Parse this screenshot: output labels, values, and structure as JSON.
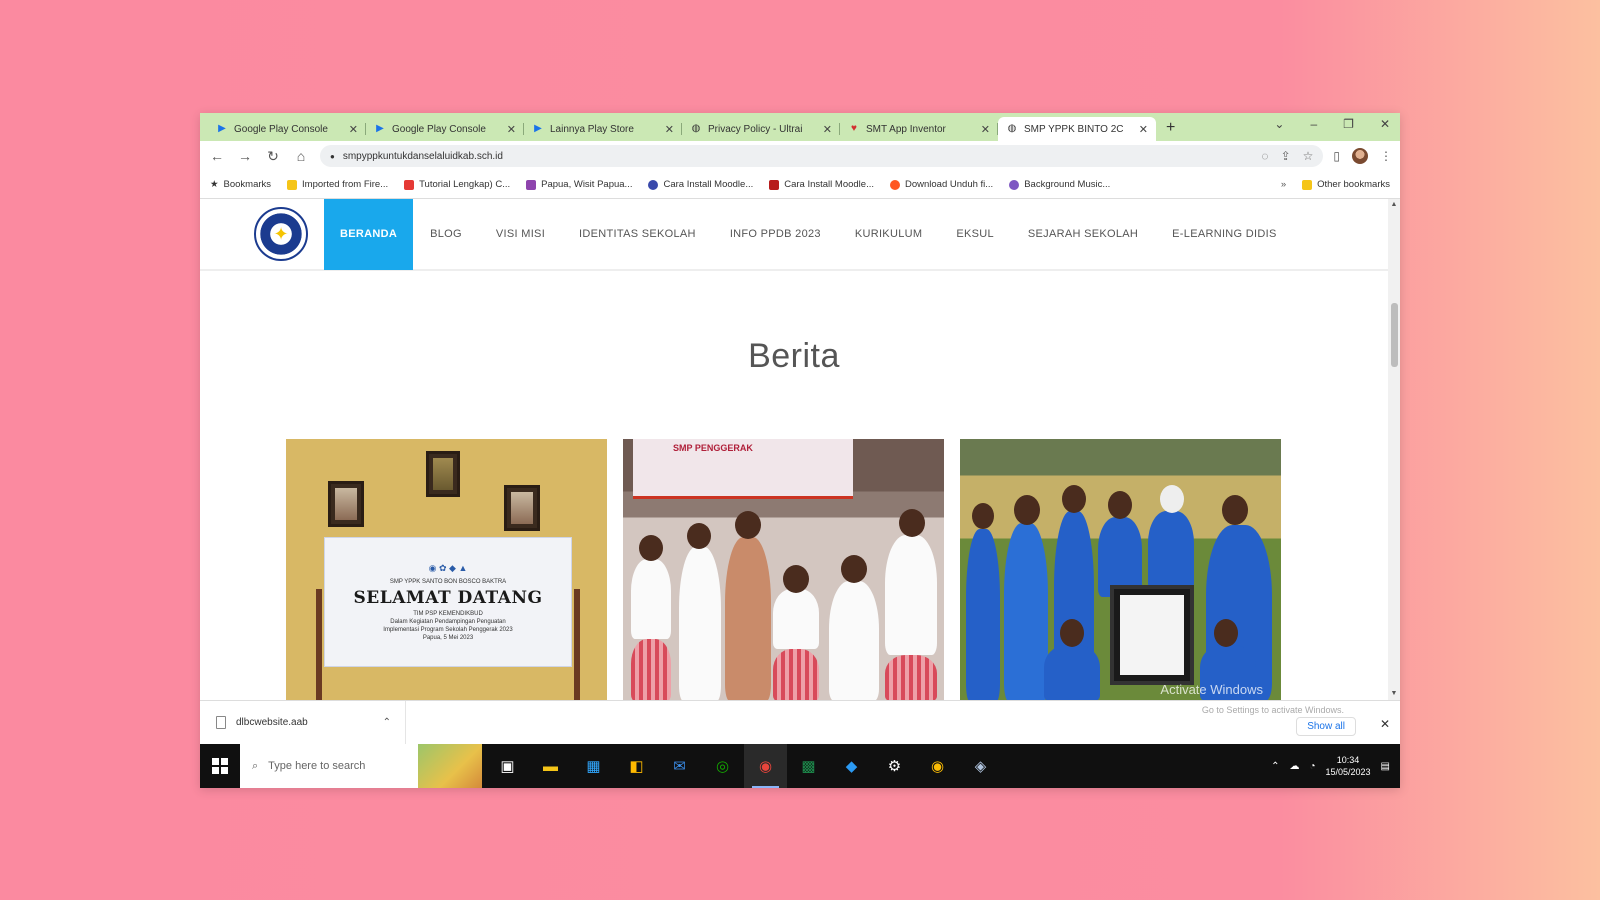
{
  "browser": {
    "tabs": [
      {
        "title": "Google Play Console",
        "icon": "google-play-icon",
        "active": false
      },
      {
        "title": "Google Play Console",
        "icon": "google-play-icon",
        "active": false
      },
      {
        "title": "Lainnya Play Store",
        "icon": "google-play-icon",
        "active": false
      },
      {
        "title": "Privacy Policy - Ultrai",
        "icon": "globe-icon",
        "active": false
      },
      {
        "title": "SMT App Inventor",
        "icon": "app-inventor-icon",
        "active": false
      },
      {
        "title": "SMP YPPK BINTO 2C",
        "icon": "globe-icon",
        "active": true
      }
    ],
    "url": "smpyppkuntukdanselaluidkab.sch.id",
    "bookmarks": [
      {
        "label": "Bookmarks",
        "color": "#222222"
      },
      {
        "label": "Imported from Fire...",
        "color": "#f5c518"
      },
      {
        "label": "Tutorial Lengkap) C...",
        "color": "#e53935"
      },
      {
        "label": "Papua, Wisit Papua...",
        "color": "#8e44ad"
      },
      {
        "label": "Cara Install Moodle...",
        "color": "#3949ab"
      },
      {
        "label": "Cara Install Moodle...",
        "color": "#b71c1c"
      },
      {
        "label": "Download Unduh fi...",
        "color": "#ff5722"
      },
      {
        "label": "Background Music...",
        "color": "#7e57c2"
      }
    ],
    "other_bookmarks": "Other bookmarks"
  },
  "site": {
    "nav": [
      "BERANDA",
      "BLOG",
      "VISI MISI",
      "IDENTITAS SEKOLAH",
      "INFO PPDB 2023",
      "KURIKULUM",
      "EKSUL",
      "SEJARAH SEKOLAH",
      "E-LEARNING DIDIS"
    ],
    "section_title": "Berita",
    "card1_banner": {
      "small_top": "SMP YPPK SANTO BON BOSCO BAKTRA",
      "big": "SELAMAT DATANG",
      "line1": "TIM PSP KEMENDIKBUD",
      "line2": "Dalam Kegiatan Pendampingan Penguatan",
      "line3": "Implementasi Program Sekolah Penggerak 2023",
      "line4": "Papua, 5 Mei 2023"
    },
    "card2_poster": "SMP PENGGERAK",
    "watermark": "Activate Windows"
  },
  "downloads": {
    "file": "dlbcwebsite.aab",
    "activate_hint": "Go to Settings to activate Windows.",
    "show_all": "Show all"
  },
  "taskbar": {
    "search_placeholder": "Type here to search",
    "time": "10:34",
    "date": "15/05/2023"
  }
}
